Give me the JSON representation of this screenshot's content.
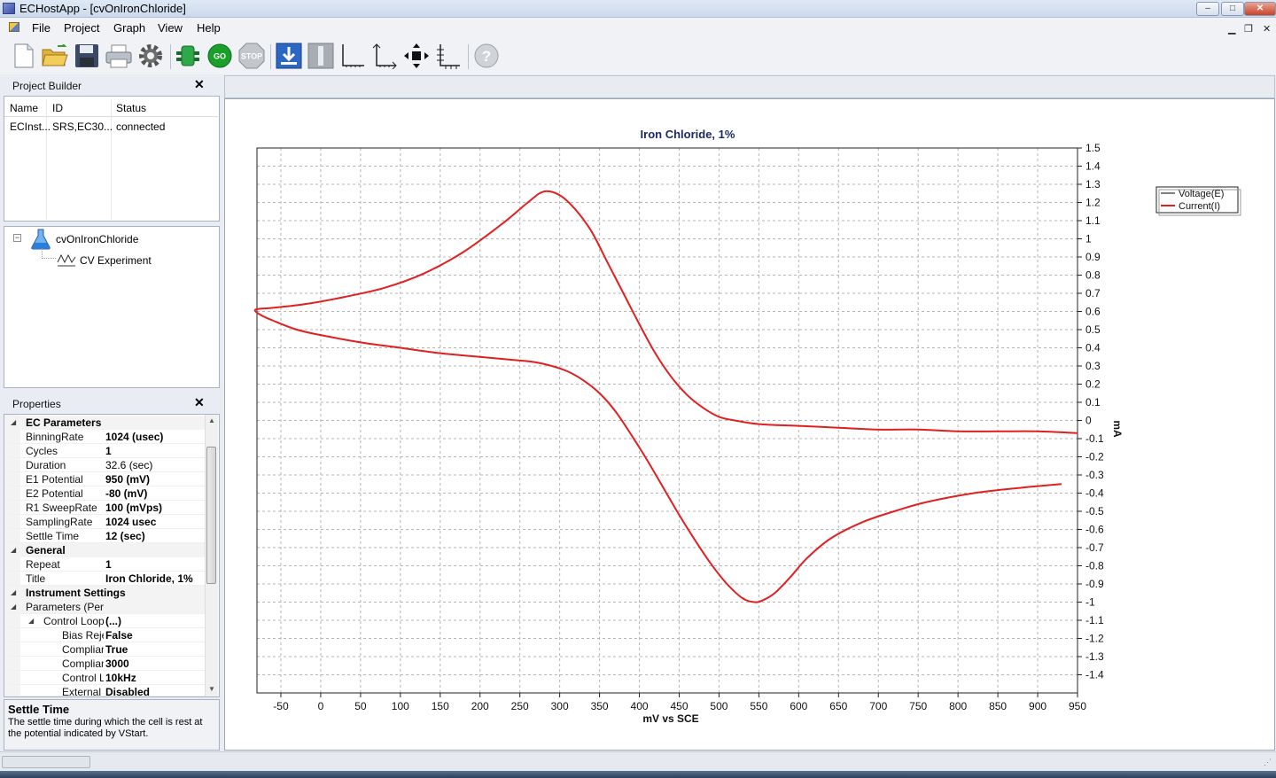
{
  "window": {
    "title": "ECHostApp - [cvOnIronChloride]"
  },
  "menu": {
    "file": "File",
    "project": "Project",
    "graph": "Graph",
    "view": "View",
    "help": "Help"
  },
  "toolbar": {
    "go_label": "GO",
    "stop_label": "STOP",
    "help_label": "?"
  },
  "project_builder": {
    "title": "Project Builder",
    "columns": [
      "Name",
      "ID",
      "Status"
    ],
    "rows": [
      {
        "name": "ECInst...",
        "id": "SRS,EC30...",
        "status": "connected"
      }
    ],
    "tree_root": "cvOnIronChloride",
    "tree_child": "CV Experiment"
  },
  "properties": {
    "title": "Properties",
    "ec_parameters": "EC Parameters",
    "binning_rate": {
      "name": "BinningRate",
      "value": "1024 (usec)"
    },
    "cycles": {
      "name": "Cycles",
      "value": "1"
    },
    "duration": {
      "name": "Duration",
      "value": "32.6 (sec)"
    },
    "e1_potential": {
      "name": "E1 Potential",
      "value": "950 (mV)"
    },
    "e2_potential": {
      "name": "E2 Potential",
      "value": "-80 (mV)"
    },
    "r1_sweeprate": {
      "name": "R1 SweepRate",
      "value": "100 (mVps)"
    },
    "sampling_rate": {
      "name": "SamplingRate",
      "value": "1024 usec"
    },
    "settle_time": {
      "name": "Settle Time",
      "value": "12 (sec)"
    },
    "general": "General",
    "repeat": {
      "name": "Repeat",
      "value": "1"
    },
    "title_prop": {
      "name": "Title",
      "value": "Iron Chloride, 1%"
    },
    "instrument_settings": "Instrument Settings",
    "parameters_per": "Parameters (Per e:",
    "control_loop": {
      "name": "Control Loop",
      "value": "(...)"
    },
    "bias_reje": {
      "name": "Bias Reje",
      "value": "False"
    },
    "complian1": {
      "name": "Complian",
      "value": "True"
    },
    "complian2": {
      "name": "Complian",
      "value": "3000"
    },
    "control_l": {
      "name": "Control L",
      "value": "10kHz"
    },
    "external": {
      "name": "External i",
      "value": "Disabled"
    },
    "description_title": "Settle Time",
    "description_text": "The settle time during which the cell is rest at the potential indicated by VStart."
  },
  "chart_data": {
    "type": "line",
    "title": "Iron Chloride, 1%",
    "xlabel": "mV vs SCE",
    "ylabel": "mA",
    "xlim": [
      -80,
      950
    ],
    "ylim": [
      -1.5,
      1.5
    ],
    "xticks": [
      -50,
      0,
      50,
      100,
      150,
      200,
      250,
      300,
      350,
      400,
      450,
      500,
      550,
      600,
      650,
      700,
      750,
      800,
      850,
      900,
      950
    ],
    "yticks": [
      1.5,
      1.4,
      1.3,
      1.2,
      1.1,
      1,
      0.9,
      0.8,
      0.7,
      0.6,
      0.5,
      0.4,
      0.3,
      0.2,
      0.1,
      0,
      -0.1,
      -0.2,
      -0.3,
      -0.4,
      -0.5,
      -0.6,
      -0.7,
      -0.8,
      -0.9,
      -1,
      -1.1,
      -1.2,
      -1.3,
      -1.4
    ],
    "grid": true,
    "legend_position": "top-right",
    "series": [
      {
        "name": "Voltage(E)",
        "color": "#000000",
        "x": [],
        "y": []
      },
      {
        "name": "Current(I)",
        "color": "#e02020",
        "x": [
          930,
          880,
          820,
          760,
          720,
          680,
          640,
          610,
          590,
          570,
          555,
          545,
          530,
          510,
          490,
          470,
          450,
          430,
          410,
          390,
          370,
          350,
          330,
          310,
          290,
          270,
          250,
          200,
          150,
          100,
          50,
          0,
          -30,
          -60,
          -75,
          -82,
          -60,
          -20,
          30,
          80,
          130,
          180,
          230,
          260,
          280,
          300,
          320,
          340,
          360,
          380,
          400,
          420,
          440,
          460,
          480,
          500,
          520,
          550,
          600,
          650,
          700,
          750,
          800,
          850,
          900,
          950
        ],
        "y": [
          -0.35,
          -0.37,
          -0.4,
          -0.45,
          -0.5,
          -0.56,
          -0.65,
          -0.76,
          -0.86,
          -0.95,
          -0.99,
          -1.0,
          -0.98,
          -0.9,
          -0.79,
          -0.66,
          -0.52,
          -0.37,
          -0.22,
          -0.08,
          0.05,
          0.15,
          0.22,
          0.27,
          0.3,
          0.32,
          0.33,
          0.35,
          0.37,
          0.4,
          0.43,
          0.47,
          0.5,
          0.55,
          0.58,
          0.61,
          0.62,
          0.64,
          0.68,
          0.73,
          0.81,
          0.93,
          1.09,
          1.2,
          1.26,
          1.24,
          1.16,
          1.04,
          0.87,
          0.7,
          0.53,
          0.37,
          0.24,
          0.14,
          0.07,
          0.02,
          0.0,
          -0.02,
          -0.03,
          -0.04,
          -0.05,
          -0.05,
          -0.06,
          -0.06,
          -0.06,
          -0.07
        ]
      }
    ]
  }
}
